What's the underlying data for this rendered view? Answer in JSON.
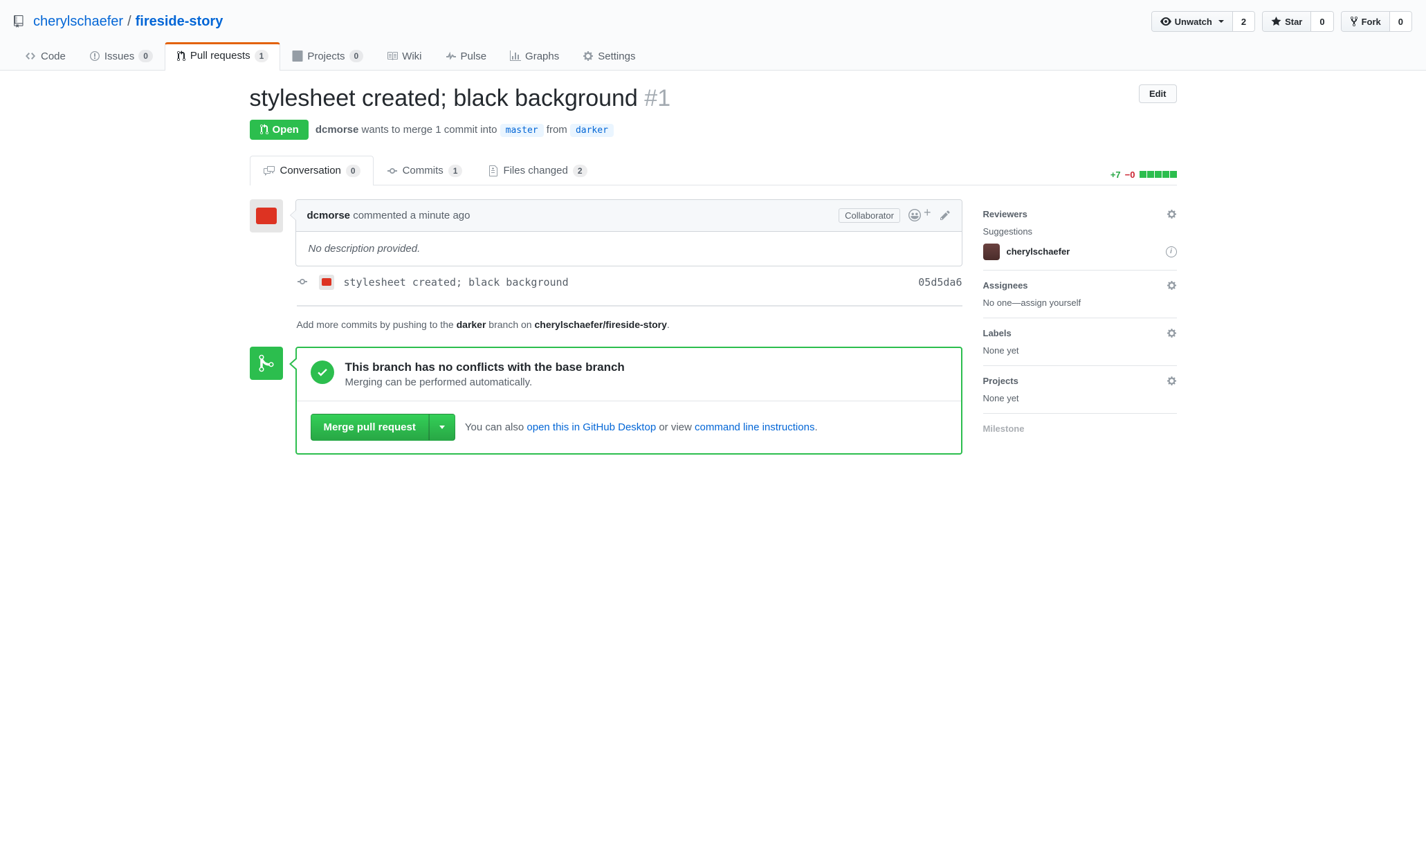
{
  "repo": {
    "owner": "cherylschaefer",
    "name": "fireside-story"
  },
  "actions": {
    "unwatch": {
      "label": "Unwatch",
      "count": "2"
    },
    "star": {
      "label": "Star",
      "count": "0"
    },
    "fork": {
      "label": "Fork",
      "count": "0"
    }
  },
  "nav": {
    "code": "Code",
    "issues": {
      "label": "Issues",
      "count": "0"
    },
    "pulls": {
      "label": "Pull requests",
      "count": "1"
    },
    "projects": {
      "label": "Projects",
      "count": "0"
    },
    "wiki": "Wiki",
    "pulse": "Pulse",
    "graphs": "Graphs",
    "settings": "Settings"
  },
  "pr": {
    "title": "stylesheet created; black background",
    "number": "#1",
    "edit": "Edit",
    "state": "Open",
    "author": "dcmorse",
    "merge_text_1": "wants to merge 1 commit into",
    "base": "master",
    "from_word": "from",
    "head": "darker"
  },
  "tabs": {
    "conversation": {
      "label": "Conversation",
      "count": "0"
    },
    "commits": {
      "label": "Commits",
      "count": "1"
    },
    "files": {
      "label": "Files changed",
      "count": "2"
    }
  },
  "diffstat": {
    "additions": "+7",
    "deletions": "−0"
  },
  "comment": {
    "author": "dcmorse",
    "action": "commented a minute ago",
    "badge": "Collaborator",
    "body": "No description provided."
  },
  "commit": {
    "message": "stylesheet created; black background",
    "sha": "05d5da6"
  },
  "push_hint": {
    "pre": "Add more commits by pushing to the ",
    "branch": "darker",
    "mid": " branch on ",
    "repo": "cherylschaefer/fireside-story",
    "post": "."
  },
  "merge": {
    "title": "This branch has no conflicts with the base branch",
    "subtitle": "Merging can be performed automatically.",
    "button": "Merge pull request",
    "hint_pre": "You can also ",
    "hint_link1": "open this in GitHub Desktop",
    "hint_mid": " or view ",
    "hint_link2": "command line instructions",
    "hint_post": "."
  },
  "sidebar": {
    "reviewers": {
      "title": "Reviewers",
      "subtitle": "Suggestions",
      "suggestion": "cherylschaefer"
    },
    "assignees": {
      "title": "Assignees",
      "body": "No one—assign yourself"
    },
    "labels": {
      "title": "Labels",
      "body": "None yet"
    },
    "projects": {
      "title": "Projects",
      "body": "None yet"
    },
    "milestone": {
      "title": "Milestone"
    }
  }
}
